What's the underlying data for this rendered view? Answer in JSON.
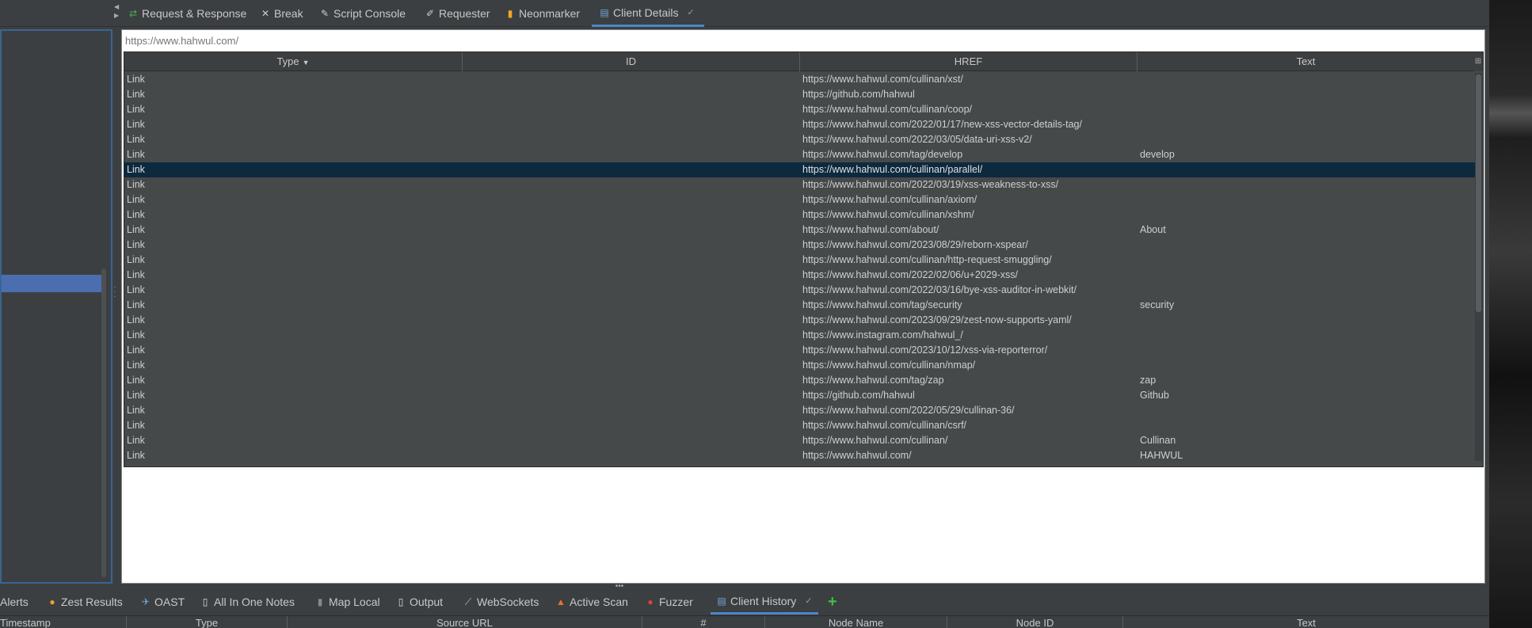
{
  "top_tabs": [
    {
      "label": "Request & Response",
      "icon": "swap-arrows-icon",
      "glyph": "⇄",
      "color": "#4caf50"
    },
    {
      "label": "Break",
      "icon": "close-icon",
      "glyph": "✕",
      "color": "#cccccc"
    },
    {
      "label": "Script Console",
      "icon": "script-icon",
      "glyph": "✎",
      "color": "#cccccc"
    },
    {
      "label": "Requester",
      "icon": "requester-icon",
      "glyph": "✐",
      "color": "#cccccc"
    },
    {
      "label": "Neonmarker",
      "icon": "neonmarker-icon",
      "glyph": "▮",
      "color": "#f5a623"
    },
    {
      "label": "Client Details",
      "icon": "client-details-icon",
      "glyph": "▤",
      "color": "#6fa8dc",
      "active": true,
      "pinned": "✓"
    }
  ],
  "url_input": {
    "placeholder": "https://www.hahwul.com/",
    "value": ""
  },
  "table": {
    "columns": [
      "Type",
      "ID",
      "HREF",
      "Text"
    ],
    "sorted_column": "Type",
    "sort_glyph": "▼",
    "corner_glyph": "⊞",
    "selected_row": 6,
    "rows": [
      [
        "Link",
        "",
        "https://www.hahwul.com/cullinan/xst/",
        ""
      ],
      [
        "Link",
        "",
        "https://github.com/hahwul",
        ""
      ],
      [
        "Link",
        "",
        "https://www.hahwul.com/cullinan/coop/",
        ""
      ],
      [
        "Link",
        "",
        "https://www.hahwul.com/2022/01/17/new-xss-vector-details-tag/",
        ""
      ],
      [
        "Link",
        "",
        "https://www.hahwul.com/2022/03/05/data-uri-xss-v2/",
        ""
      ],
      [
        "Link",
        "",
        "https://www.hahwul.com/tag/develop",
        "develop"
      ],
      [
        "Link",
        "",
        "https://www.hahwul.com/cullinan/parallel/",
        ""
      ],
      [
        "Link",
        "",
        "https://www.hahwul.com/2022/03/19/xss-weakness-to-xss/",
        ""
      ],
      [
        "Link",
        "",
        "https://www.hahwul.com/cullinan/axiom/",
        ""
      ],
      [
        "Link",
        "",
        "https://www.hahwul.com/cullinan/xshm/",
        ""
      ],
      [
        "Link",
        "",
        "https://www.hahwul.com/about/",
        "About"
      ],
      [
        "Link",
        "",
        "https://www.hahwul.com/2023/08/29/reborn-xspear/",
        ""
      ],
      [
        "Link",
        "",
        "https://www.hahwul.com/cullinan/http-request-smuggling/",
        ""
      ],
      [
        "Link",
        "",
        "https://www.hahwul.com/2022/02/06/u+2029-xss/",
        ""
      ],
      [
        "Link",
        "",
        "https://www.hahwul.com/2022/03/16/bye-xss-auditor-in-webkit/",
        ""
      ],
      [
        "Link",
        "",
        "https://www.hahwul.com/tag/security",
        "security"
      ],
      [
        "Link",
        "",
        "https://www.hahwul.com/2023/09/29/zest-now-supports-yaml/",
        ""
      ],
      [
        "Link",
        "",
        "https://www.instagram.com/hahwul_/",
        ""
      ],
      [
        "Link",
        "",
        "https://www.hahwul.com/2023/10/12/xss-via-reporterror/",
        ""
      ],
      [
        "Link",
        "",
        "https://www.hahwul.com/cullinan/nmap/",
        ""
      ],
      [
        "Link",
        "",
        "https://www.hahwul.com/tag/zap",
        "zap"
      ],
      [
        "Link",
        "",
        "https://github.com/hahwul",
        "Github"
      ],
      [
        "Link",
        "",
        "https://www.hahwul.com/2022/05/29/cullinan-36/",
        ""
      ],
      [
        "Link",
        "",
        "https://www.hahwul.com/cullinan/csrf/",
        ""
      ],
      [
        "Link",
        "",
        "https://www.hahwul.com/cullinan/",
        "Cullinan"
      ],
      [
        "Link",
        "",
        "https://www.hahwul.com/",
        "HAHWUL"
      ]
    ]
  },
  "bottom_tabs": [
    {
      "label": "Alerts",
      "icon": "",
      "glyph": "",
      "color": "#cccccc"
    },
    {
      "label": "Zest Results",
      "icon": "zest-icon",
      "glyph": "●",
      "color": "#f0a030"
    },
    {
      "label": "OAST",
      "icon": "oast-icon",
      "glyph": "✈",
      "color": "#6fa8dc"
    },
    {
      "label": "All In One Notes",
      "icon": "notes-icon",
      "glyph": "▯",
      "color": "#dddddd"
    },
    {
      "label": "Map Local",
      "icon": "map-local-icon",
      "glyph": "▮",
      "color": "#888888"
    },
    {
      "label": "Output",
      "icon": "output-icon",
      "glyph": "▯",
      "color": "#dddddd"
    },
    {
      "label": "WebSockets",
      "icon": "websockets-icon",
      "glyph": "⟋",
      "color": "#bbbbbb"
    },
    {
      "label": "Active Scan",
      "icon": "flame-icon",
      "glyph": "▲",
      "color": "#e8702a"
    },
    {
      "label": "Fuzzer",
      "icon": "fuzzer-icon",
      "glyph": "●",
      "color": "#e04040"
    },
    {
      "label": "Client History",
      "icon": "client-history-icon",
      "glyph": "▤",
      "color": "#6fa8dc",
      "active": true,
      "pinned": "✓"
    }
  ],
  "add_tab_glyph": "+",
  "bottom_table_columns": [
    "Timestamp",
    "Type",
    "Source URL",
    "#",
    "Node Name",
    "Node ID",
    "Text"
  ],
  "colors": {
    "selection": "#0d293e",
    "tab_active": "#4a88c7",
    "panel_bg": "#3c3f41",
    "table_bg": "#45494a"
  }
}
